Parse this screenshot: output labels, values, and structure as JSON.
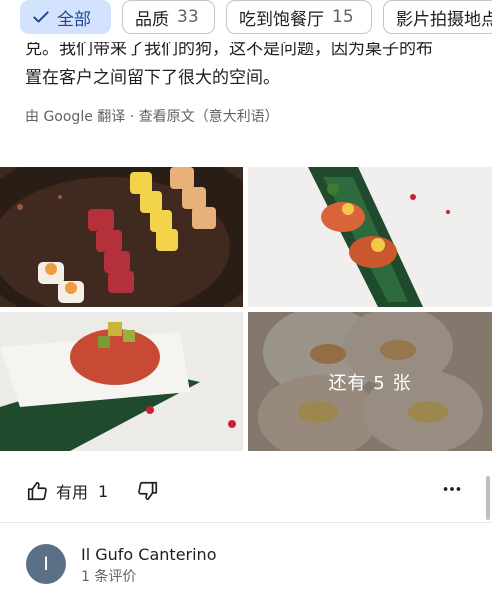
{
  "filter_chips": [
    {
      "label": "全部",
      "count": "",
      "selected": true
    },
    {
      "label": "品质",
      "count": "33",
      "selected": false
    },
    {
      "label": "吃到饱餐厅",
      "count": "15",
      "selected": false
    },
    {
      "label": "影片拍摄地点",
      "count": "",
      "selected": false
    }
  ],
  "review": {
    "text_line1": "兑。我们带来了我们的狗，这不是问题，因为桌子的布",
    "text_line2": "置在客户之间留下了很大的空间。",
    "translation_note": "由 Google 翻译 · 查看原文（意大利语）"
  },
  "photos": {
    "more_label": "还有 5 张"
  },
  "actions": {
    "helpful_label": "有用",
    "helpful_count": "1"
  },
  "next_reviewer": {
    "initial": "I",
    "name": "Il Gufo Canterino",
    "meta": "1 条评价"
  },
  "colors": {
    "selected_chip_bg": "#d3e3fd",
    "selected_chip_text": "#1d4a8f",
    "avatar_bg": "#5b6f86"
  }
}
